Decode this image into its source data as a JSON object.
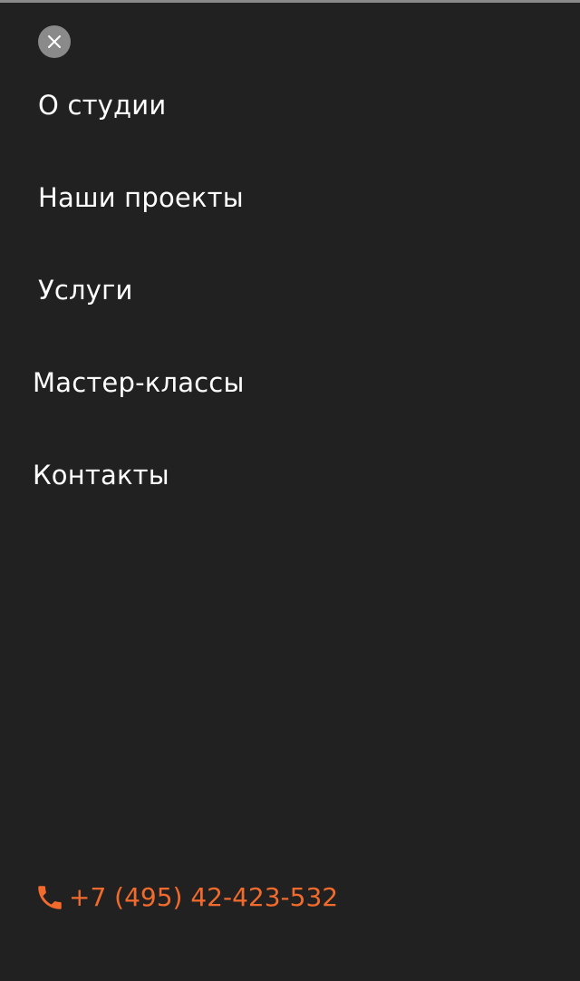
{
  "menu": {
    "close_icon": "close-icon",
    "items": [
      {
        "label": "О студии"
      },
      {
        "label": "Наши проекты"
      },
      {
        "label": "Услуги"
      },
      {
        "label": "Мастер-классы"
      },
      {
        "label": "Контакты"
      }
    ]
  },
  "contact": {
    "phone": "+7 (495) 42-423-532",
    "phone_icon": "phone-icon"
  },
  "colors": {
    "background": "#212121",
    "accent": "#f26b2c",
    "close_button_bg": "#8a8a8a",
    "text": "#ffffff"
  }
}
